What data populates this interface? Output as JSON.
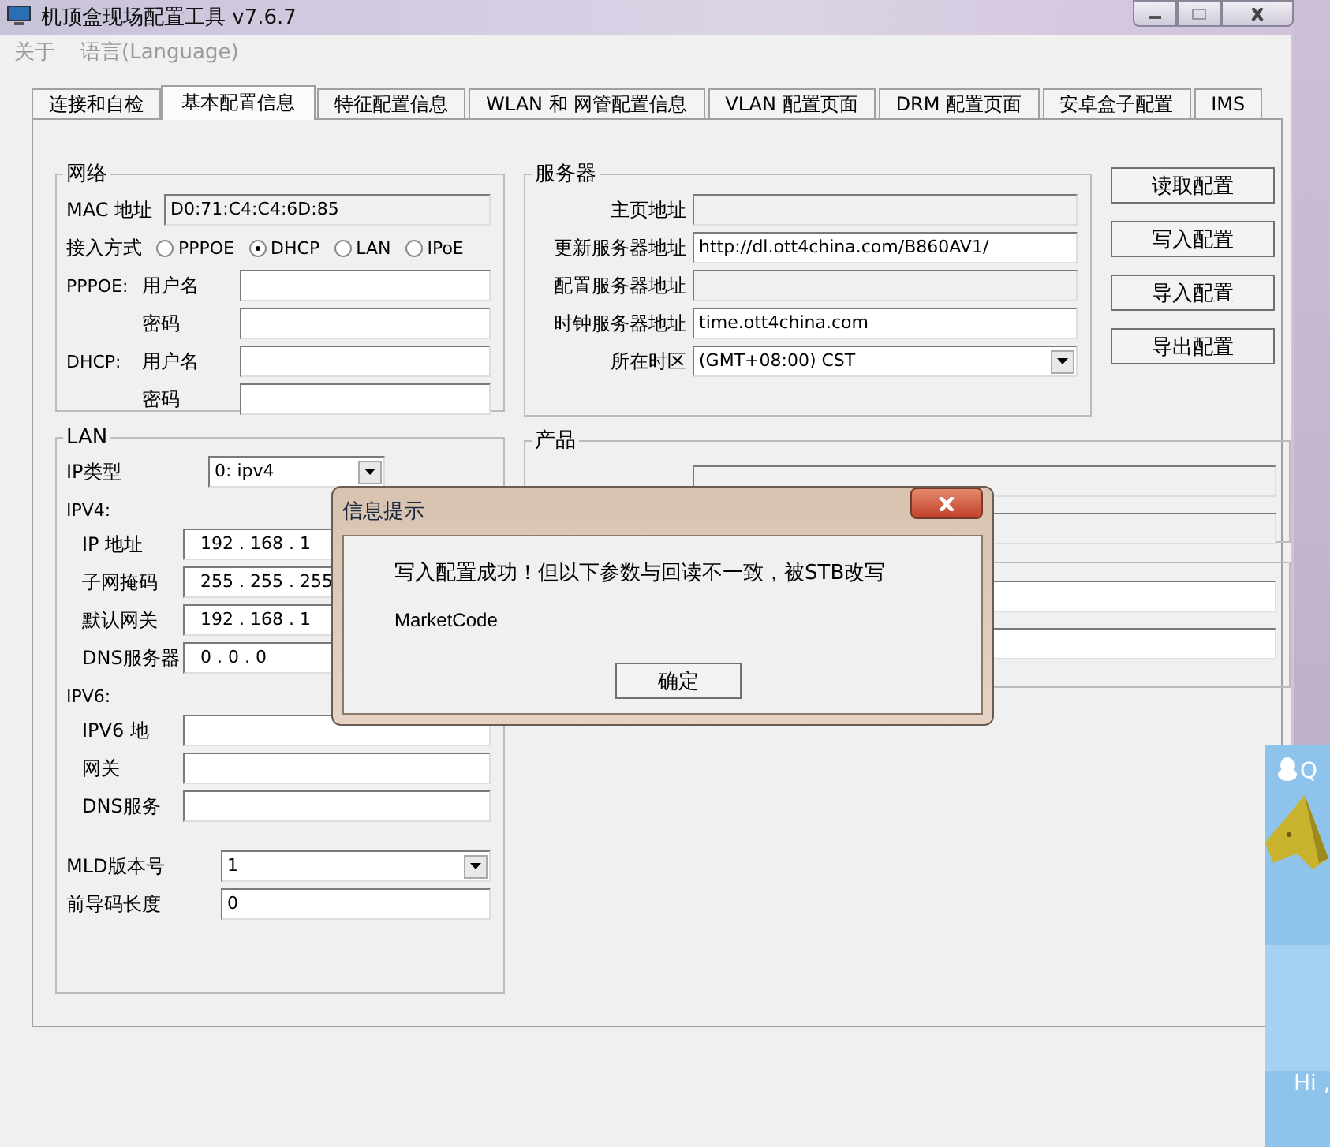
{
  "window": {
    "title": "机顶盒现场配置工具 v7.6.7"
  },
  "menu": [
    {
      "label": "关于",
      "disabled": true
    },
    {
      "label": "语言(Language)",
      "disabled": true
    }
  ],
  "tabs": [
    {
      "label": "连接和自检",
      "selected": false
    },
    {
      "label": "基本配置信息",
      "selected": true
    },
    {
      "label": "特征配置信息",
      "selected": false
    },
    {
      "label": "WLAN 和 网管配置信息",
      "selected": false
    },
    {
      "label": "VLAN 配置页面",
      "selected": false
    },
    {
      "label": "DRM 配置页面",
      "selected": false
    },
    {
      "label": "安卓盒子配置",
      "selected": false
    },
    {
      "label": "IMS",
      "selected": false
    }
  ],
  "network": {
    "title": "网络",
    "mac_label": "MAC 地址",
    "mac_value": "D0:71:C4:C4:6D:85",
    "access_label": "接入方式",
    "access_options": [
      {
        "label": "PPPOE",
        "selected": false
      },
      {
        "label": "DHCP",
        "selected": true
      },
      {
        "label": "LAN",
        "selected": false
      },
      {
        "label": "IPoE",
        "selected": false
      }
    ],
    "credentials": [
      {
        "prefix": "PPPOE:",
        "label": "用户名"
      },
      {
        "label": "密码"
      },
      {
        "prefix": "DHCP:",
        "label": "用户名"
      },
      {
        "label": "密码"
      }
    ]
  },
  "server": {
    "title": "服务器",
    "fields": [
      {
        "kind": "text",
        "label": "主页地址",
        "disabled": true
      },
      {
        "kind": "text",
        "label": "更新服务器地址",
        "value": "http://dl.ott4china.com/B860AV1/",
        "disabled": false
      },
      {
        "kind": "text",
        "label": "配置服务器地址",
        "disabled": true
      },
      {
        "kind": "text",
        "label": "时钟服务器地址",
        "value": "time.ott4china.com",
        "disabled": false
      },
      {
        "kind": "dropdown",
        "label": "所在时区",
        "value": "(GMT+08:00) CST",
        "disabled": false
      }
    ]
  },
  "actions": [
    "读取配置",
    "写入配置",
    "导入配置",
    "导出配置"
  ],
  "lan": {
    "title": "LAN",
    "ip_type_label": "IP类型",
    "ip_type": "0: ipv4",
    "ipv4_title": "IPV4:",
    "ipv4": [
      {
        "label": "IP 地址",
        "value": "192 . 168 . 1"
      },
      {
        "label": "子网掩码",
        "value": "255 . 255 . 255"
      },
      {
        "label": "默认网关",
        "value": "192 . 168 . 1"
      },
      {
        "label": "DNS服务器",
        "value": "0 . 0 . 0"
      }
    ],
    "ipv6_title": "IPV6:",
    "ipv6": [
      {
        "label": "IPV6 地"
      },
      {
        "label": "网关"
      },
      {
        "label": "DNS服务"
      }
    ],
    "mld_label": "MLD版本号",
    "mld_value": "1",
    "prefix_label": "前导码长度",
    "prefix_value": "0"
  },
  "product": {
    "title": "产品"
  },
  "dialog": {
    "title": "信息提示",
    "message": "写入配置成功！但以下参数与回读不一致，被STB改写",
    "detail": "MarketCode",
    "button": "确定"
  },
  "qq_popup": {
    "brand": "Q",
    "greeting": "Hi ,"
  }
}
